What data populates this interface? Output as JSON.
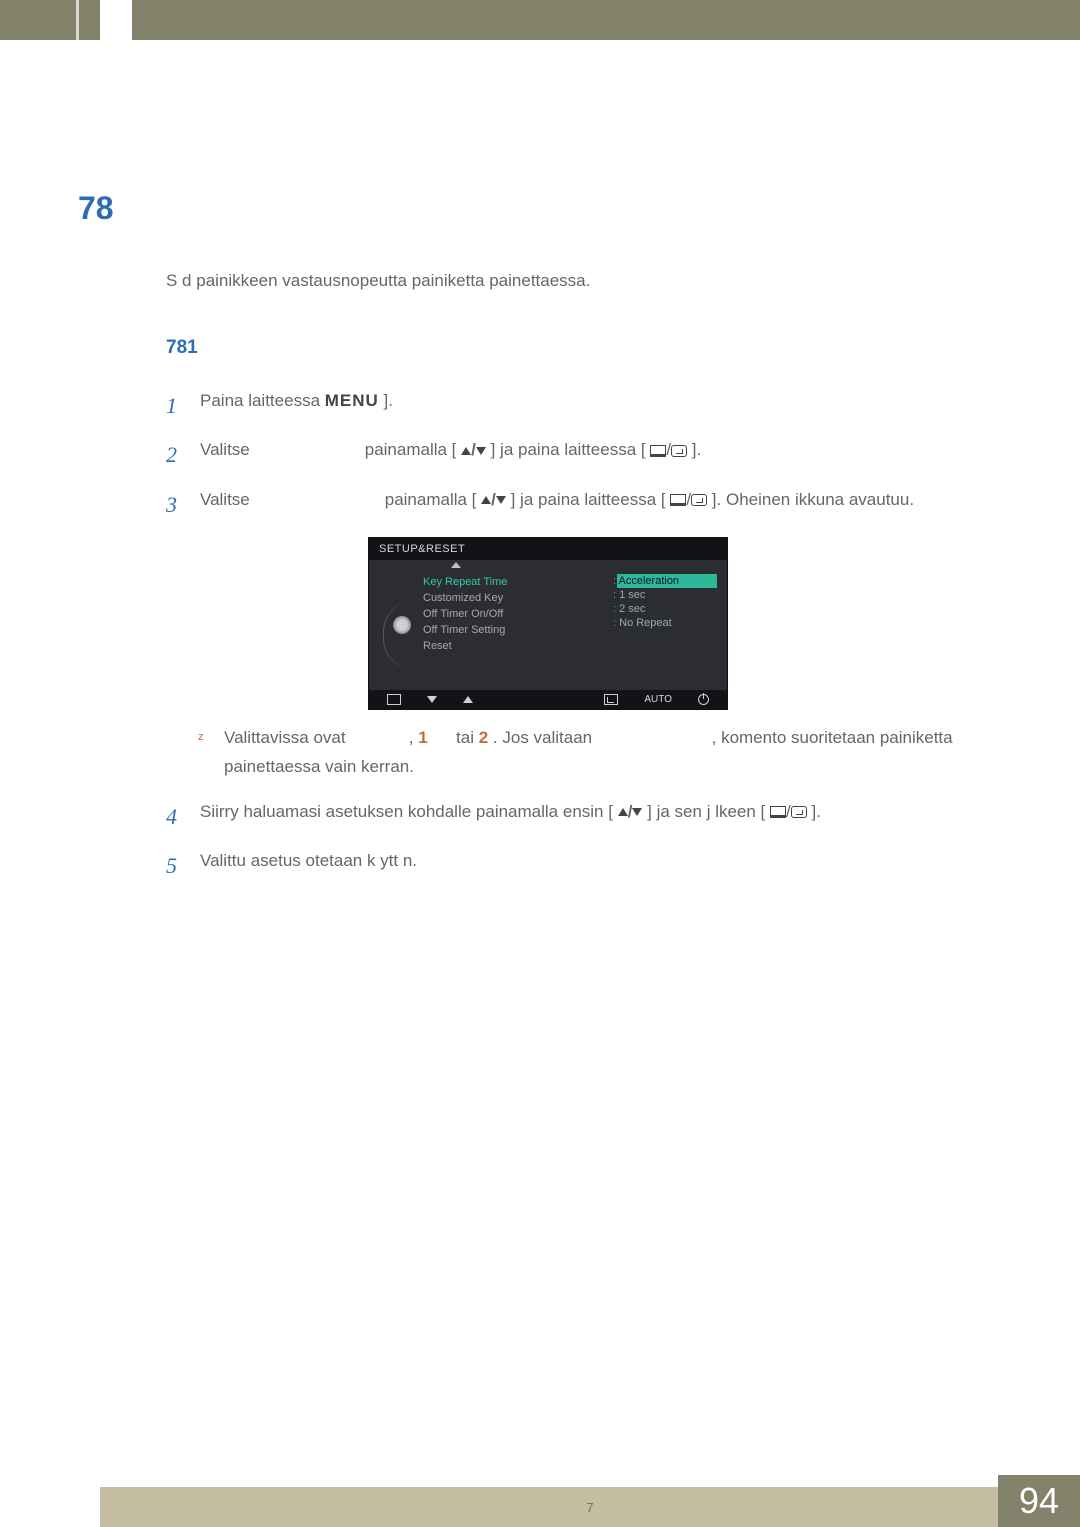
{
  "section_number": "78",
  "intro": "S d painikkeen vastausnopeutta painiketta painettaessa.",
  "subsection_number": "781",
  "steps": {
    "s1": {
      "n": "1",
      "a": "Paina laitteessa ",
      "menu": "MENU",
      "b": " ]."
    },
    "s2": {
      "n": "2",
      "a": "Valitse",
      "b": "painamalla [",
      "c": "] ja paina laitteessa [",
      "d": "]."
    },
    "s3": {
      "n": "3",
      "a": "Valitse",
      "b": "painamalla [",
      "c": "] ja paina laitteessa [",
      "d": "]. Oheinen ikkuna avautuu."
    },
    "s4": {
      "n": "4",
      "text": "Siirry haluamasi asetuksen kohdalle painamalla ensin [",
      "mid": "] ja sen j lkeen [",
      "end": "]."
    },
    "s5": {
      "n": "5",
      "text": "Valittu asetus otetaan k ytt n."
    }
  },
  "bullet": {
    "a": "Valittavissa ovat",
    "comma": ",",
    "one": "1",
    "tai": "tai",
    "two": "2",
    "mid": ". Jos valitaan",
    "b": ", komento suoritetaan painiketta painettaessa vain kerran."
  },
  "osd": {
    "title": "SETUP&RESET",
    "menu": [
      "Key Repeat Time",
      "Customized Key",
      "Off Timer On/Off",
      "Off Timer Setting",
      "Reset"
    ],
    "options": [
      "Acceleration",
      "1 sec",
      "2 sec",
      "No Repeat"
    ],
    "auto": "AUTO"
  },
  "footer_center": "7",
  "page_number": "94"
}
